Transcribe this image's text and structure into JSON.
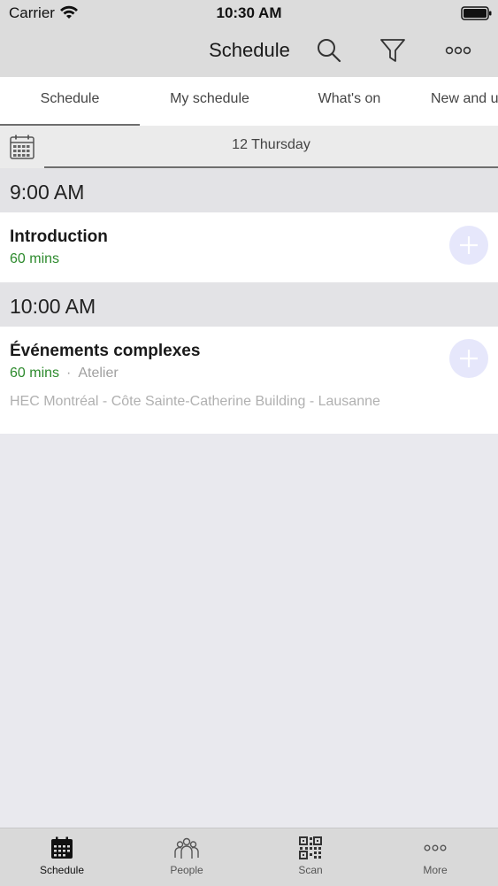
{
  "status": {
    "carrier": "Carrier",
    "time": "10:30 AM"
  },
  "nav": {
    "title": "Schedule",
    "icons": [
      "search-icon",
      "filter-icon",
      "more-icon"
    ]
  },
  "tabs": [
    {
      "label": "Schedule",
      "active": true
    },
    {
      "label": "My schedule",
      "active": false
    },
    {
      "label": "What's on",
      "active": false
    },
    {
      "label": "New and u",
      "active": false
    }
  ],
  "date_bar": {
    "label": "12 Thursday",
    "icon": "calendar-icon"
  },
  "groups": [
    {
      "time": "9:00 AM",
      "sessions": [
        {
          "title": "Introduction",
          "duration": "60 mins",
          "type": "",
          "location": ""
        }
      ]
    },
    {
      "time": "10:00 AM",
      "sessions": [
        {
          "title": "Événements complexes",
          "duration": "60 mins",
          "separator": "·",
          "type": "Atelier",
          "location": "HEC Montréal - Côte Sainte-Catherine Building - Lausanne"
        }
      ]
    }
  ],
  "bottom_tabs": [
    {
      "label": "Schedule",
      "icon": "calendar-icon",
      "active": true
    },
    {
      "label": "People",
      "icon": "people-icon",
      "active": false
    },
    {
      "label": "Scan",
      "icon": "qr-code-icon",
      "active": false
    },
    {
      "label": "More",
      "icon": "more-icon",
      "active": false
    }
  ],
  "colors": {
    "accent_green": "#2d8a2d",
    "add_button": "#e6e7fb",
    "bars": "#dcdcdc"
  }
}
